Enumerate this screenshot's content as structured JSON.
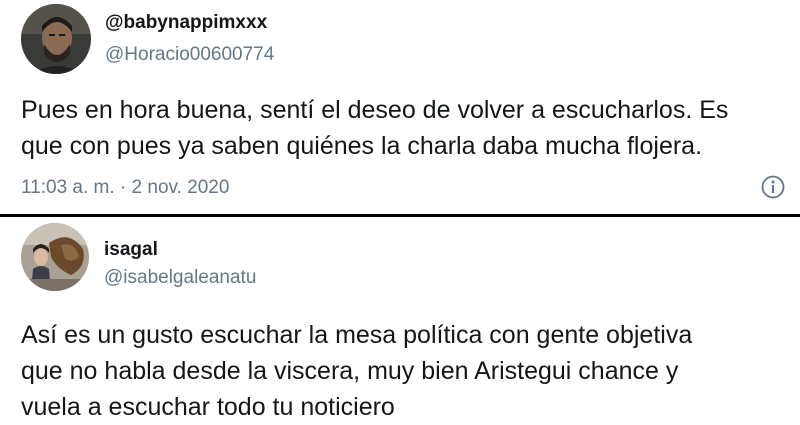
{
  "tweets": [
    {
      "display_name": "@babynappimxxx",
      "handle": "@Horacio00600774",
      "avatar_icon": "profile-photo-man-beard",
      "lines": [
        "Pues en hora buena, sentí el deseo de volver a escucharlos. Es",
        "que con pues ya saben quiénes la charla daba mucha flojera."
      ],
      "timestamp": "11:03 a. m. · 2 nov. 2020",
      "info_icon": "info-circle-icon"
    },
    {
      "display_name": "isagal",
      "handle": "@isabelgaleanatu",
      "avatar_icon": "profile-photo-woman-statue",
      "lines": [
        "Así es un gusto escuchar la mesa política con gente objetiva",
        "que no habla desde la viscera, muy bien Aristegui chance y",
        "vuela a escuchar todo tu noticiero"
      ]
    }
  ],
  "colors": {
    "text": "#14171a",
    "secondary": "#657786",
    "divider": "#000000",
    "background": "#ffffff"
  }
}
